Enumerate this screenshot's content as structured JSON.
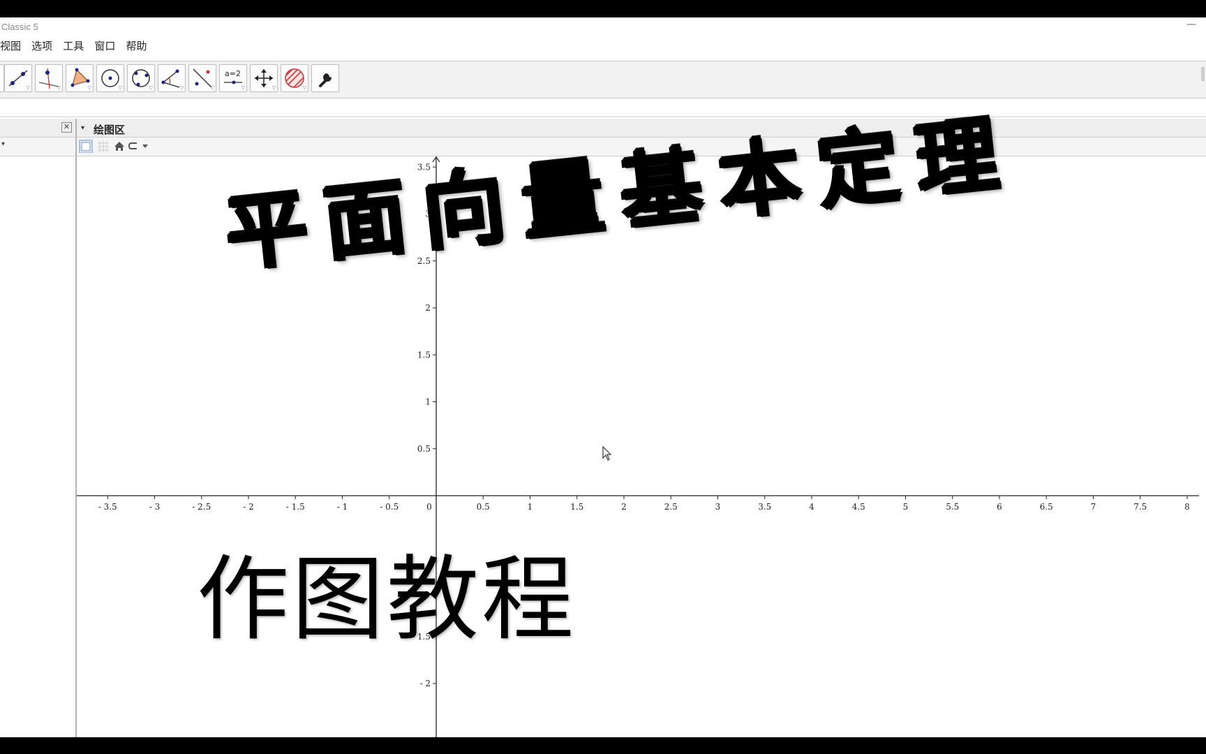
{
  "window": {
    "title": "Classic 5",
    "minimize_glyph": "—"
  },
  "menu": {
    "items": [
      "视图",
      "选项",
      "工具",
      "窗口",
      "帮助"
    ]
  },
  "toolbar": {
    "tools": [
      {
        "name": "move-graphics-icon"
      },
      {
        "name": "line-through-points-icon"
      },
      {
        "name": "perpendicular-line-icon"
      },
      {
        "name": "polygon-icon"
      },
      {
        "name": "circle-center-point-icon"
      },
      {
        "name": "circle-three-points-icon"
      },
      {
        "name": "angle-icon"
      },
      {
        "name": "reflect-about-line-icon"
      },
      {
        "name": "slider-icon",
        "label": "a=2"
      },
      {
        "name": "move-graphics-view-icon"
      },
      {
        "name": "hatched-region-icon"
      },
      {
        "name": "wrench-icon"
      }
    ]
  },
  "left_panel": {
    "close_glyph": "✕",
    "chevron_glyph": "▾"
  },
  "graphics_view": {
    "title": "绘图区",
    "chevron_glyph": "▾"
  },
  "overlay": {
    "banner_text": "平面向量基本定理",
    "subtitle_text": "作图教程"
  },
  "chart_data": {
    "type": "scatter",
    "title": "",
    "xlabel": "",
    "ylabel": "",
    "x_ticks": [
      "-3.5",
      "-3",
      "-2.5",
      "-2",
      "-1.5",
      "-1",
      "-0.5",
      "0",
      "0.5",
      "1",
      "1.5",
      "2",
      "2.5",
      "3",
      "3.5",
      "4",
      "4.5",
      "5",
      "5.5",
      "6",
      "6.5",
      "7",
      "7.5",
      "8"
    ],
    "y_ticks_visible": [
      "3.5",
      "3",
      "2.5",
      "2",
      "1.5",
      "1",
      "0.5",
      "-1.5",
      "-2"
    ],
    "xlim": [
      -3.8,
      8.2
    ],
    "ylim": [
      -2.5,
      3.6
    ],
    "grid": false,
    "series": []
  },
  "colors": {
    "toolbar_bg": "#f2f2f2",
    "accent_point": "#1a237e",
    "hatch_red": "#d32f2f"
  }
}
